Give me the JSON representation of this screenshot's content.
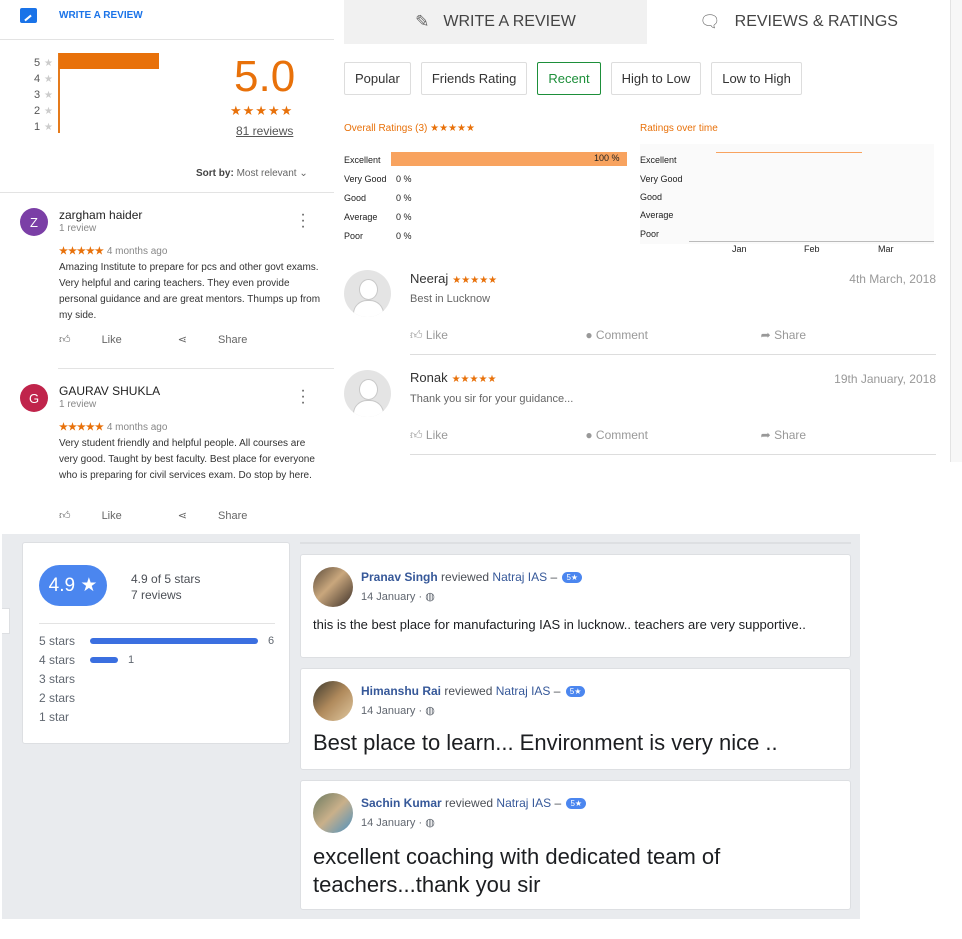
{
  "google": {
    "write_label": "WRITE A REVIEW",
    "rating_rows": [
      {
        "n": "5"
      },
      {
        "n": "4"
      },
      {
        "n": "3"
      },
      {
        "n": "2"
      },
      {
        "n": "1"
      }
    ],
    "star_glyph": "★",
    "five_star_share": 1.0,
    "score": "5.0",
    "stars": "★★★★★",
    "review_count": "81 reviews",
    "sort_label": "Sort by:",
    "sort_value": "Most relevant",
    "reviews": [
      {
        "initial": "Z",
        "color": "#7b3fa6",
        "name": "zargham haider",
        "sub": "1 review",
        "stars": "★★★★★",
        "age": "4 months ago",
        "text": "Amazing Institute to prepare for pcs and other govt exams. Very helpful and caring teachers. They even provide personal guidance and are great mentors. Thumps up from my side.",
        "like": "Like",
        "share": "Share"
      },
      {
        "initial": "G",
        "color": "#c0244b",
        "name": "GAURAV SHUKLA",
        "sub": "1 review",
        "stars": "★★★★★",
        "age": "4 months ago",
        "text": "Very student friendly and helpful people. All courses are very good. Taught by best faculty. Best place for everyone who is preparing for civil services exam. Do stop by here.",
        "like": "Like",
        "share": "Share"
      }
    ]
  },
  "justdial": {
    "tabs": [
      {
        "label": "WRITE A REVIEW",
        "icon": "pencil-icon"
      },
      {
        "label": "REVIEWS & RATINGS",
        "icon": "speech-bubble-icon"
      }
    ],
    "filters": [
      "Popular",
      "Friends Rating",
      "Recent",
      "High to Low",
      "Low to High"
    ],
    "selected_filter": "Recent",
    "overall_title": "Overall Ratings (3) ★★★★★",
    "over_time_title": "Ratings over time",
    "breakdown": [
      {
        "label": "Excellent",
        "pct": "100 %",
        "value": 1.0
      },
      {
        "label": "Very Good",
        "pct": "0 %",
        "value": 0
      },
      {
        "label": "Good",
        "pct": "0 %",
        "value": 0
      },
      {
        "label": "Average",
        "pct": "0 %",
        "value": 0
      },
      {
        "label": "Poor",
        "pct": "0 %",
        "value": 0
      }
    ],
    "time_labels": [
      "Excellent",
      "Very Good",
      "Good",
      "Average",
      "Poor"
    ],
    "months": [
      "Jan",
      "Feb",
      "Mar"
    ],
    "reviews": [
      {
        "name": "Neeraj",
        "stars": "★★★★★",
        "date": "4th March, 2018",
        "text": "Best in Lucknow",
        "like": "Like",
        "comment": "Comment",
        "share": "Share"
      },
      {
        "name": "Ronak",
        "stars": "★★★★★",
        "date": "19th January, 2018",
        "text": "Thank you sir for your guidance...",
        "like": "Like",
        "comment": "Comment",
        "share": "Share"
      }
    ]
  },
  "facebook": {
    "score_pill": "4.9 ★",
    "score_text": "4.9 of 5 stars",
    "reviews_text": "7 reviews",
    "distribution": [
      {
        "label": "5 stars",
        "count": "6",
        "fraction": 1.0
      },
      {
        "label": "4 stars",
        "count": "1",
        "fraction": 0.1667
      },
      {
        "label": "3 stars",
        "count": "",
        "fraction": 0
      },
      {
        "label": "2 stars",
        "count": "",
        "fraction": 0
      },
      {
        "label": "1 star",
        "count": "",
        "fraction": 0
      }
    ],
    "posts": [
      {
        "name": "Pranav Singh",
        "verb": "reviewed",
        "page": "Natraj IAS",
        "dash": "–",
        "badge": "5★",
        "date": "14 January · ◍",
        "text": "this is the best place for manufacturing IAS in lucknow.. teachers are very supportive..",
        "big": false
      },
      {
        "name": "Himanshu Rai",
        "verb": "reviewed",
        "page": "Natraj IAS",
        "dash": "–",
        "badge": "5★",
        "date": "14 January · ◍",
        "text": "Best place to learn... Environment is very nice ..",
        "big": true
      },
      {
        "name": "Sachin Kumar",
        "verb": "reviewed",
        "page": "Natraj IAS",
        "dash": "–",
        "badge": "5★",
        "date": "14 January · ◍",
        "text": "excellent coaching with dedicated team of teachers...thank you sir",
        "big": true
      }
    ]
  }
}
